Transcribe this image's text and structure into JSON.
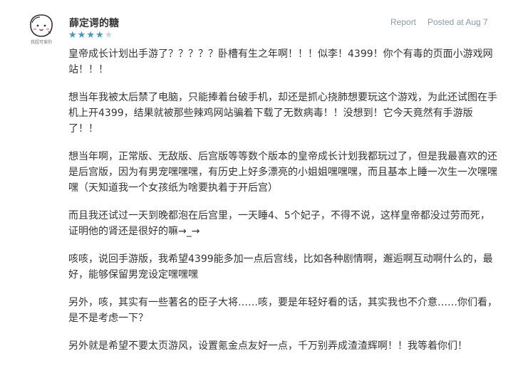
{
  "review": {
    "author": "薛定谔的糖",
    "avatar_caption": "我超可爱的",
    "rating": 4,
    "max_rating": 5,
    "report_label": "Report",
    "posted": "Posted at Aug 7",
    "paragraphs": [
      "皇帝成长计划出手游了？？？？？卧槽有生之年啊！！！似李！4399！你个有毒的页面小游戏网站！！！",
      "想当年我被太后禁了电脑，只能捧着台破手机，却还是抓心挠肺想要玩这个游戏，为此还试图在手机上开4399，结果就被那些辣鸡网站骗着下载了无数病毒！！没想到！它今天竟然有手游版了！！",
      "想当年啊，正常版、无敌版、后宫版等等数个版本的皇帝成长计划我都玩过了，但是我最喜欢的还是后宫版，因为有男宠嘿嘿嘿，有历史上好多漂亮的小姐姐嘿嘿嘿，而且基本上睡一次生一次嘿嘿嘿（天知道我一个女孩纸为啥要执着于开后宫）",
      "而且我还试过一天到晚都泡在后宫里，一天睡4、5个妃子，不得不说，这样皇帝都没过劳而死，证明他的肾还是很好的嘛→_→",
      "咳咳，说回手游版，我希望4399能多加一点后宫线，比如各种剧情啊，邂逅啊互动啊什么的，最好，能够保留男宠设定嘿嘿嘿",
      "另外，咳，其实有一些著名的臣子大将……咳，要是年轻好看的话，其实我也不介意……你们看，是不是考虑一下？",
      "另外就是希望不要太页游风，设置氪金点友好一点，千万别弄成渣渣辉啊！！我等着你们！"
    ]
  }
}
